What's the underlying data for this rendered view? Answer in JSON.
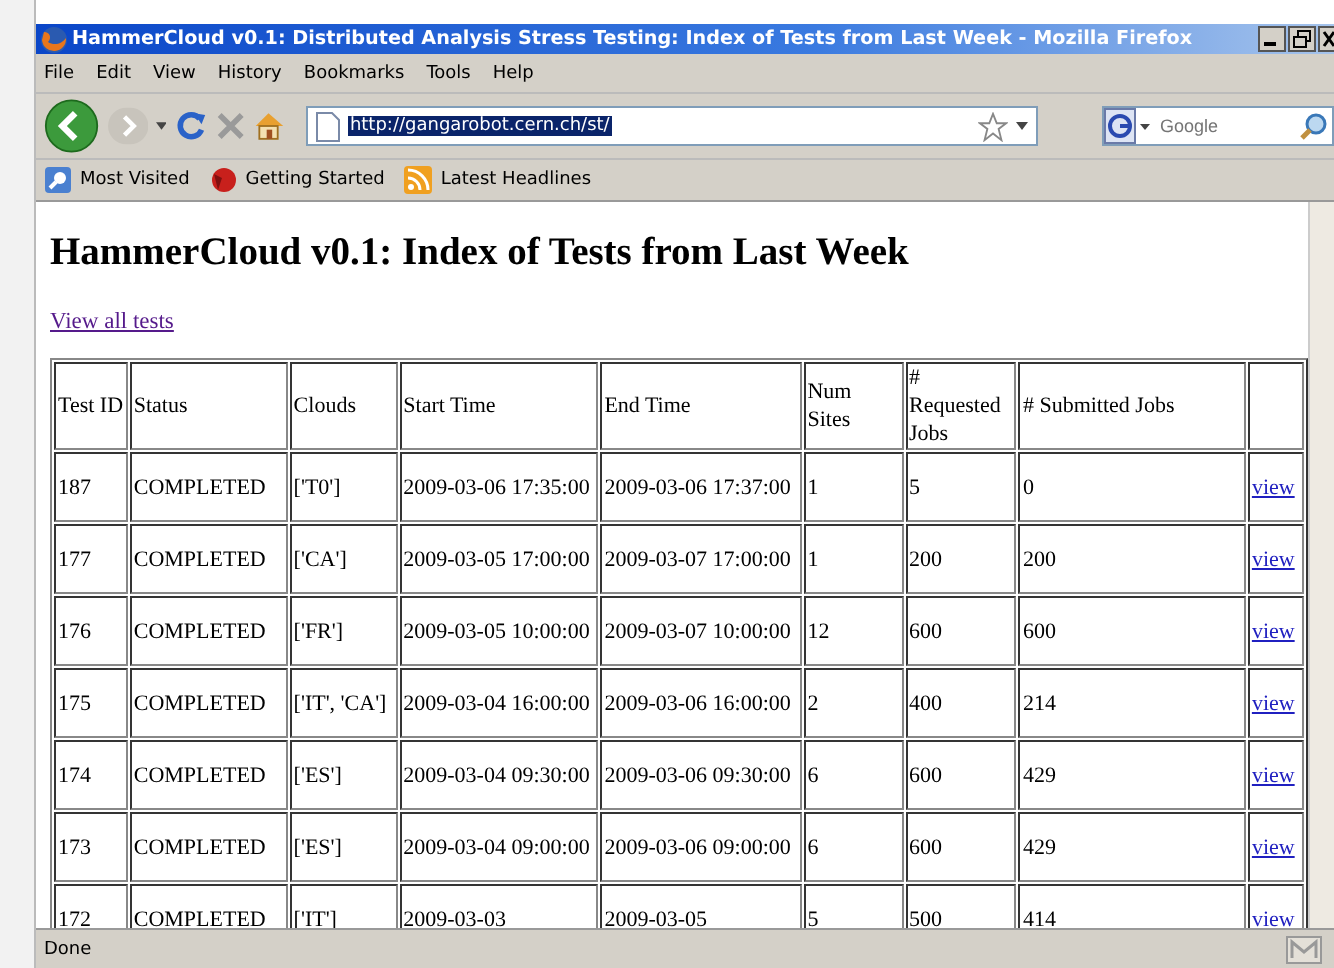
{
  "window": {
    "title": "HammerCloud v0.1: Distributed Analysis Stress Testing: Index of Tests from Last Week - Mozilla Firefox"
  },
  "menu": [
    "File",
    "Edit",
    "View",
    "History",
    "Bookmarks",
    "Tools",
    "Help"
  ],
  "address": {
    "value": "http://gangarobot.cern.ch/st/",
    "selected": true
  },
  "search": {
    "placeholder": "Google"
  },
  "bookmarks": [
    {
      "label": "Most Visited",
      "kind": "folder"
    },
    {
      "label": "Getting Started",
      "kind": "firefox"
    },
    {
      "label": "Latest Headlines",
      "kind": "feed"
    }
  ],
  "page": {
    "heading": "HammerCloud v0.1: Index of Tests from Last Week",
    "link": "View all tests",
    "table": {
      "columns": [
        "Test ID",
        "Status",
        "Clouds",
        "Start Time",
        "End Time",
        "Num Sites",
        "# Requested Jobs",
        "# Submitted Jobs"
      ],
      "rows": [
        {
          "cells": [
            "187",
            "COMPLETED",
            "['T0']",
            "2009-03-06 17:35:00",
            "2009-03-06 17:37:00",
            "1",
            "5",
            "0"
          ],
          "link": "view"
        },
        {
          "cells": [
            "177",
            "COMPLETED",
            "['CA']",
            "2009-03-05 17:00:00",
            "2009-03-07 17:00:00",
            "1",
            "200",
            "200"
          ],
          "link": "view"
        },
        {
          "cells": [
            "176",
            "COMPLETED",
            "['FR']",
            "2009-03-05 10:00:00",
            "2009-03-07 10:00:00",
            "12",
            "600",
            "600"
          ],
          "link": "view"
        },
        {
          "cells": [
            "175",
            "COMPLETED",
            "['IT', 'CA']",
            "2009-03-04 16:00:00",
            "2009-03-06 16:00:00",
            "2",
            "400",
            "214"
          ],
          "link": "view"
        },
        {
          "cells": [
            "174",
            "COMPLETED",
            "['ES']",
            "2009-03-04 09:30:00",
            "2009-03-06 09:30:00",
            "6",
            "600",
            "429"
          ],
          "link": "view"
        },
        {
          "cells": [
            "173",
            "COMPLETED",
            "['ES']",
            "2009-03-04 09:00:00",
            "2009-03-06 09:00:00",
            "6",
            "600",
            "429"
          ],
          "link": "view"
        },
        {
          "cells": [
            "172",
            "COMPLETED",
            "['IT']",
            "2009-03-03",
            "2009-03-05",
            "5",
            "500",
            "414"
          ],
          "link": "view"
        }
      ]
    }
  },
  "status_bar": {
    "text": "Done"
  }
}
